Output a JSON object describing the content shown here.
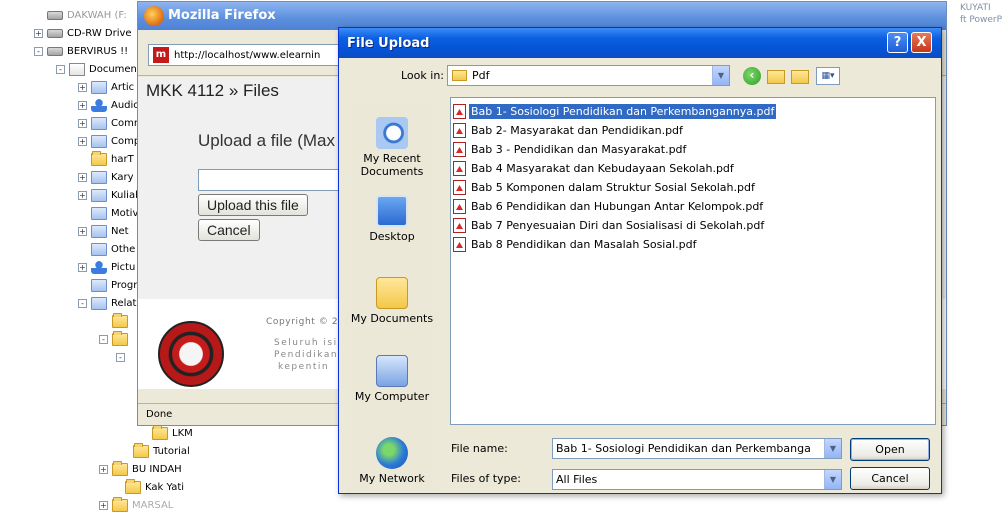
{
  "explorer": {
    "items": [
      {
        "label": "DAKWAH (F:",
        "icon": "drive-icon"
      },
      {
        "label": "CD-RW Drive",
        "icon": "drive-icon"
      },
      {
        "label": "BERVIRUS !!",
        "icon": "drive-icon"
      },
      {
        "label": "Documen",
        "icon": "documents-icon"
      },
      {
        "label": "Artic",
        "icon": "folder-icon"
      },
      {
        "label": "Audio",
        "icon": "folder-icon"
      },
      {
        "label": "Comr",
        "icon": "folder-icon"
      },
      {
        "label": "Comp",
        "icon": "folder-icon"
      },
      {
        "label": "harT",
        "icon": "folder-icon"
      },
      {
        "label": "Kary",
        "icon": "folder-icon"
      },
      {
        "label": "Kuliah",
        "icon": "folder-icon"
      },
      {
        "label": "Motiv",
        "icon": "folder-icon"
      },
      {
        "label": "Net",
        "icon": "folder-icon"
      },
      {
        "label": "Othe",
        "icon": "folder-icon"
      },
      {
        "label": "Pictu",
        "icon": "folder-icon"
      },
      {
        "label": "Progr",
        "icon": "folder-icon"
      },
      {
        "label": "Relat",
        "icon": "folder-icon"
      },
      {
        "label": "LKM",
        "icon": "folder-icon"
      },
      {
        "label": "Tutorial",
        "icon": "folder-icon"
      },
      {
        "label": "BU INDAH",
        "icon": "folder-icon"
      },
      {
        "label": "Kak Yati",
        "icon": "folder-icon"
      },
      {
        "label": "MARSAL",
        "icon": "folder-icon"
      }
    ],
    "right_text_1": "KUYATI",
    "right_text_2": "ft PowerP"
  },
  "firefox": {
    "title": "Mozilla Firefox",
    "url": "http://localhost/www.elearnin",
    "page_heading": "MKK 4112 » Files",
    "upload_title": "Upload a file (Max",
    "upload_button": "Upload this file",
    "cancel_button": "Cancel",
    "copyright": "Copyright © 20",
    "footer_line1": "Seluruh isi/c",
    "footer_line2": "Pendidikan",
    "footer_line3": "kepentin",
    "status": "Done"
  },
  "dialog": {
    "title": "File Upload",
    "help_label": "?",
    "close_label": "X",
    "look_in_label": "Look in:",
    "look_in_value": "Pdf",
    "places": [
      {
        "label": "My Recent Documents",
        "icon": "recent-documents-icon"
      },
      {
        "label": "Desktop",
        "icon": "desktop-icon"
      },
      {
        "label": "My Documents",
        "icon": "my-documents-icon"
      },
      {
        "label": "My Computer",
        "icon": "my-computer-icon"
      },
      {
        "label": "My Network",
        "icon": "my-network-icon"
      }
    ],
    "files": [
      "Bab 1- Sosiologi Pendidikan dan Perkembangannya.pdf",
      "Bab 2- Masyarakat dan Pendidikan.pdf",
      "Bab 3 - Pendidikan dan Masyarakat.pdf",
      "Bab 4 Masyarakat dan Kebudayaan Sekolah.pdf",
      "Bab 5 Komponen dalam Struktur Sosial Sekolah.pdf",
      "Bab 6 Pendidikan dan Hubungan Antar Kelompok.pdf",
      "Bab 7 Penyesuaian Diri dan Sosialisasi di Sekolah.pdf",
      "Bab 8 Pendidikan dan Masalah Sosial.pdf"
    ],
    "selected_index": 0,
    "file_name_label": "File name:",
    "file_name_value": "Bab 1- Sosiologi Pendidikan dan Perkembanga",
    "file_type_label": "Files of type:",
    "file_type_value": "All Files",
    "open_button": "Open",
    "cancel_button": "Cancel"
  },
  "colors": {
    "selection": "#316ac5",
    "titlebar_blue": "#0554d8",
    "close_red": "#c4361a"
  }
}
